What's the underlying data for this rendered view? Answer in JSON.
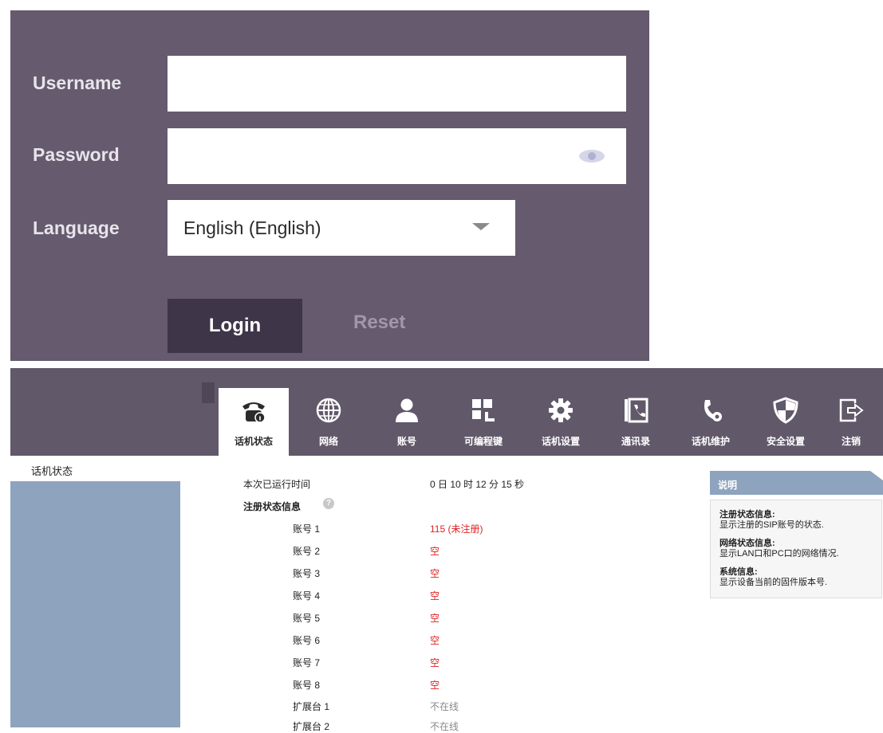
{
  "login": {
    "username_label": "Username",
    "password_label": "Password",
    "language_label": "Language",
    "username_value": "",
    "password_value": "",
    "language_value": "English (English)",
    "login_label": "Login",
    "reset_label": "Reset"
  },
  "nav": {
    "items": [
      {
        "label": "话机状态",
        "icon": "phone-icon",
        "active": true
      },
      {
        "label": "网络",
        "icon": "globe-icon"
      },
      {
        "label": "账号",
        "icon": "user-icon"
      },
      {
        "label": "可编程键",
        "icon": "keypad-icon"
      },
      {
        "label": "话机设置",
        "icon": "gear-icon"
      },
      {
        "label": "通讯录",
        "icon": "contacts-icon"
      },
      {
        "label": "话机维护",
        "icon": "maintenance-icon"
      },
      {
        "label": "安全设置",
        "icon": "shield-icon"
      },
      {
        "label": "注销",
        "icon": "logout-icon"
      }
    ]
  },
  "sidebar": {
    "current": "话机状态"
  },
  "status": {
    "uptime_label": "本次已运行时间",
    "uptime_value": "0 日 10 时 12 分 15 秒",
    "reg_section": "注册状态信息",
    "accounts": [
      {
        "label": "账号 1",
        "value": "115 (未注册)"
      },
      {
        "label": "账号 2",
        "value": "空"
      },
      {
        "label": "账号 3",
        "value": "空"
      },
      {
        "label": "账号 4",
        "value": "空"
      },
      {
        "label": "账号 5",
        "value": "空"
      },
      {
        "label": "账号 6",
        "value": "空"
      },
      {
        "label": "账号 7",
        "value": "空"
      },
      {
        "label": "账号 8",
        "value": "空"
      }
    ],
    "expansions": [
      {
        "label": "扩展台 1",
        "value": "不在线"
      },
      {
        "label": "扩展台 2",
        "value": "不在线"
      }
    ]
  },
  "help": {
    "title": "说明",
    "sections": [
      {
        "head": "注册状态信息:",
        "body": "显示注册的SIP账号的状态."
      },
      {
        "head": "网络状态信息:",
        "body": "显示LAN口和PC口的网络情况."
      },
      {
        "head": "系统信息:",
        "body": "显示设备当前的固件版本号."
      }
    ]
  },
  "colors": {
    "login_bg": "#655a6e",
    "topbar_bg": "#61586a",
    "sidebar_bg": "#8ea3be",
    "status_red": "#e02020"
  }
}
